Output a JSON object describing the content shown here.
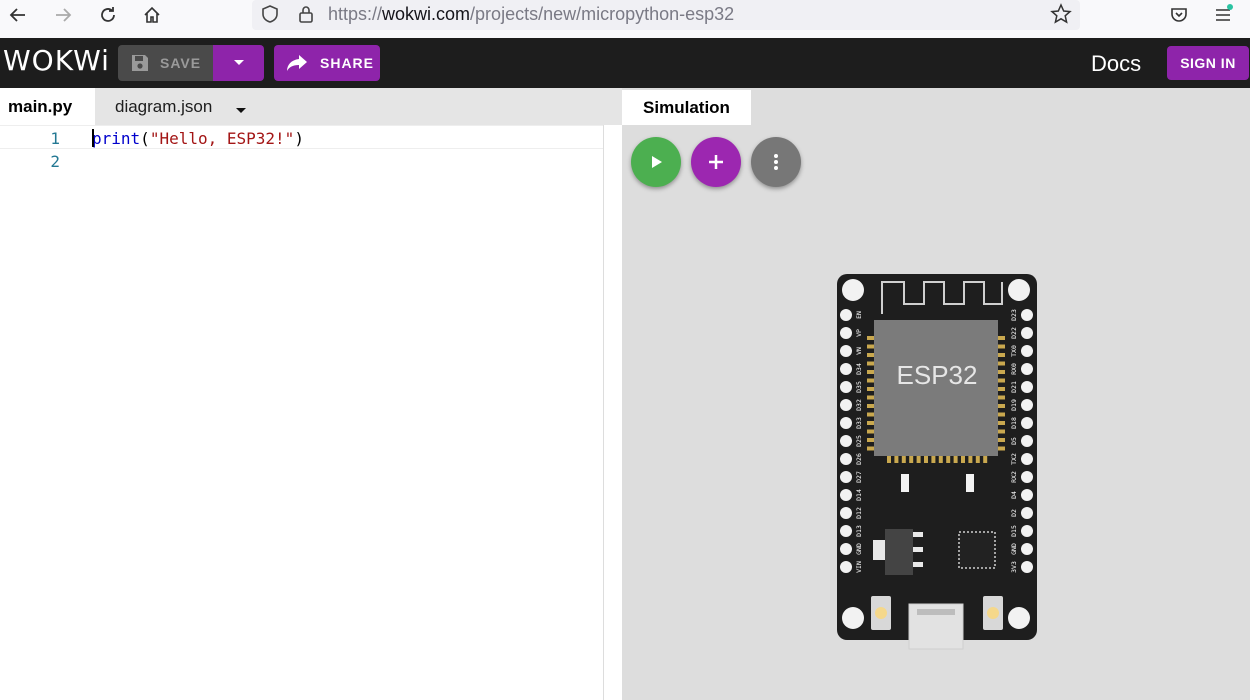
{
  "browser": {
    "url_prefix": "https://",
    "url_domain": "wokwi.com",
    "url_path": "/projects/new/micropython-esp32"
  },
  "header": {
    "logo": "WOKWi",
    "save_label": "SAVE",
    "share_label": "SHARE",
    "docs_label": "Docs",
    "signin_label": "SIGN IN"
  },
  "editor": {
    "tabs": [
      {
        "label": "main.py",
        "active": true
      },
      {
        "label": "diagram.json",
        "active": false
      }
    ],
    "lines": [
      {
        "number": "1",
        "keyword": "print",
        "open": "(",
        "string": "\"Hello, ESP32!\"",
        "close": ")"
      },
      {
        "number": "2"
      }
    ]
  },
  "simulation": {
    "tab_label": "Simulation",
    "board": {
      "chip_label": "ESP32",
      "left_pins": [
        "EN",
        "VP",
        "VN",
        "D34",
        "D35",
        "D32",
        "D33",
        "D25",
        "D26",
        "D27",
        "D14",
        "D12",
        "D13",
        "GND",
        "VIN"
      ],
      "right_pins": [
        "D23",
        "D22",
        "TX0",
        "RX0",
        "D21",
        "D19",
        "D18",
        "D5",
        "TX2",
        "RX2",
        "D4",
        "D2",
        "D15",
        "GND",
        "3V3"
      ]
    }
  },
  "colors": {
    "accent": "#8e24aa",
    "run": "#4caf50",
    "add": "#9c27b0",
    "header_bg": "#1d1d1d"
  },
  "icons": [
    "back-icon",
    "forward-icon",
    "reload-icon",
    "home-icon",
    "shield-icon",
    "lock-icon",
    "star-icon",
    "pocket-icon",
    "menu-icon",
    "floppy-icon",
    "chevron-down-icon",
    "share-icon",
    "play-icon",
    "plus-icon",
    "more-vertical-icon"
  ]
}
